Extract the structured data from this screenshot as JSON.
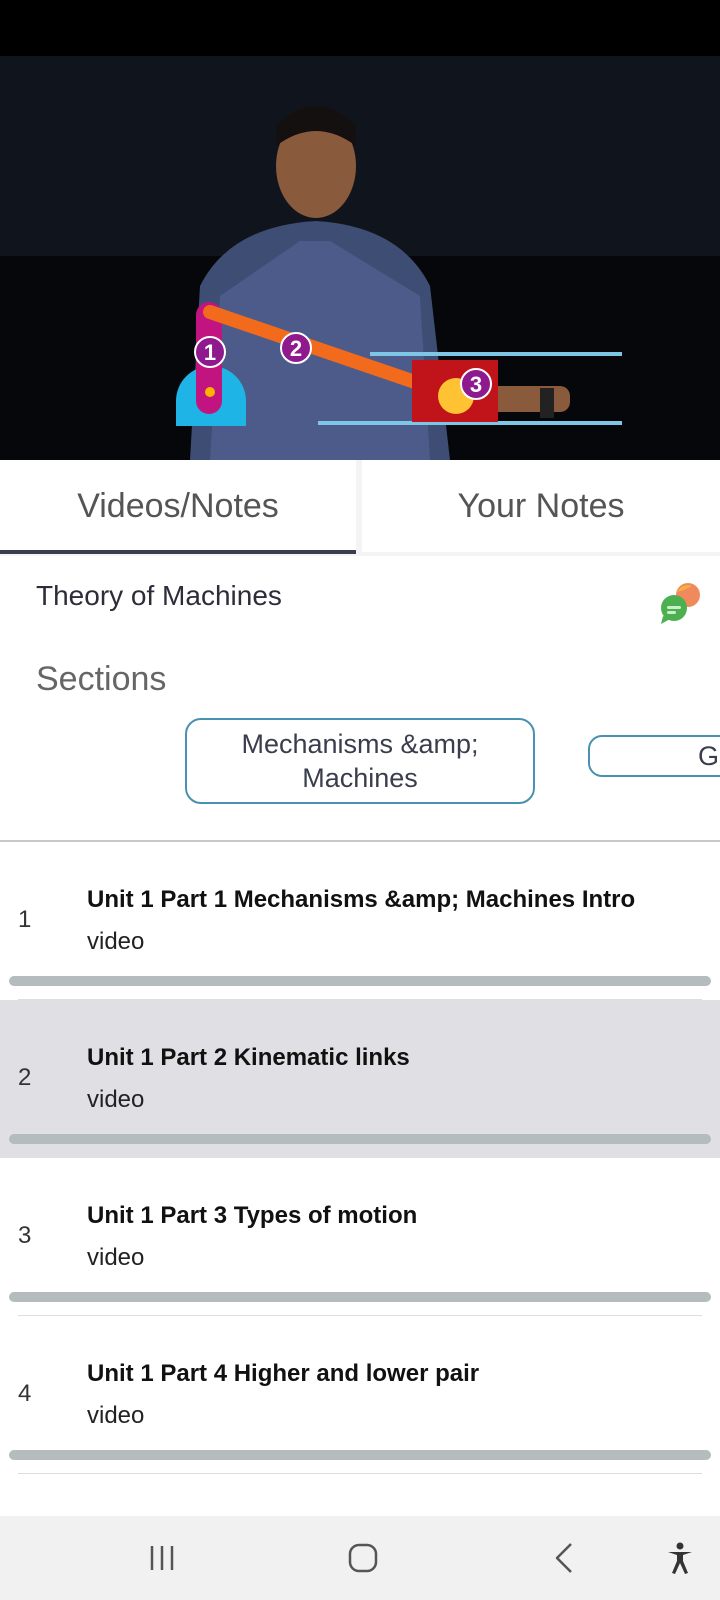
{
  "tabs": {
    "videos_notes": "Videos/Notes",
    "your_notes": "Your Notes"
  },
  "course": {
    "title": "Theory of Machines"
  },
  "sections": {
    "label": "Sections",
    "chips": [
      {
        "label": "Mechanisms &amp; Machines",
        "selected": true
      },
      {
        "label": "Ge",
        "selected": false
      }
    ]
  },
  "lessons": [
    {
      "number": "1",
      "title": "Unit 1 Part 1 Mechanisms &amp; Machines Intro",
      "type": "video",
      "selected": false
    },
    {
      "number": "2",
      "title": "Unit 1 Part 2 Kinematic links",
      "type": "video",
      "selected": true
    },
    {
      "number": "3",
      "title": "Unit 1 Part 3 Types of motion",
      "type": "video",
      "selected": false
    },
    {
      "number": "4",
      "title": "Unit 1 Part 4 Higher and lower pair",
      "type": "video",
      "selected": false
    }
  ],
  "video": {
    "diagram_markers": [
      "1",
      "2",
      "3"
    ]
  },
  "icons": {
    "chat": "chat-bubbles-icon",
    "nav_recent": "recent-apps-icon",
    "nav_home": "home-icon",
    "nav_back": "back-icon",
    "nav_accessibility": "accessibility-icon"
  },
  "colors": {
    "tab_indicator": "#3a3d4d",
    "chip_border": "#4a90b0",
    "selected_row": "#e0e0e4",
    "progress_track": "#b5bcbd"
  }
}
